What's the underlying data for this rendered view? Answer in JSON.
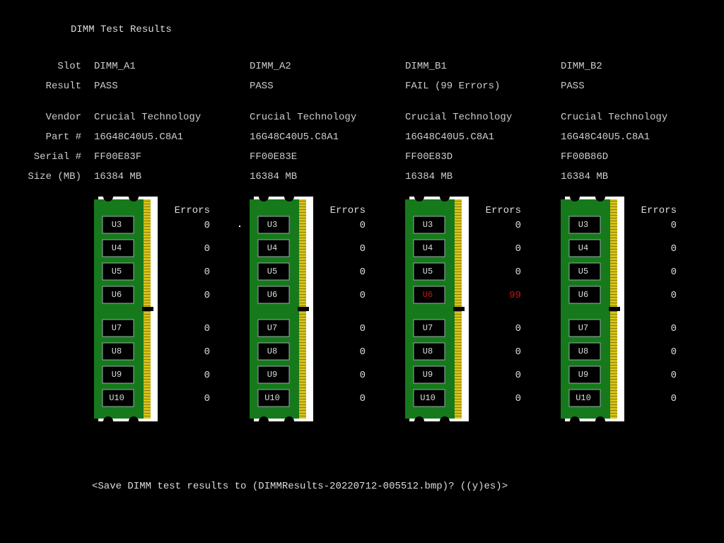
{
  "title": "DIMM Test Results",
  "row_labels": {
    "slot": "Slot",
    "result": "Result",
    "vendor": "Vendor",
    "part": "Part #",
    "serial": "Serial #",
    "size": "Size (MB)"
  },
  "errors_header": "Errors",
  "columns": [
    {
      "slot": "DIMM_A1",
      "result": "PASS",
      "result_status": "pass",
      "vendor": "Crucial Technology",
      "part": "16G48C40U5.C8A1",
      "serial": "FF00E83F",
      "size": "16384 MB",
      "chips": [
        {
          "label": "U3",
          "errors": "0",
          "bad": false
        },
        {
          "label": "U4",
          "errors": "0",
          "bad": false
        },
        {
          "label": "U5",
          "errors": "0",
          "bad": false
        },
        {
          "label": "U6",
          "errors": "0",
          "bad": false
        },
        {
          "label": "U7",
          "errors": "0",
          "bad": false
        },
        {
          "label": "U8",
          "errors": "0",
          "bad": false
        },
        {
          "label": "U9",
          "errors": "0",
          "bad": false
        },
        {
          "label": "U10",
          "errors": "0",
          "bad": false
        }
      ]
    },
    {
      "slot": "DIMM_A2",
      "result": "PASS",
      "result_status": "pass",
      "vendor": "Crucial Technology",
      "part": "16G48C40U5.C8A1",
      "serial": "FF00E83E",
      "size": "16384 MB",
      "chips": [
        {
          "label": "U3",
          "errors": "0",
          "bad": false
        },
        {
          "label": "U4",
          "errors": "0",
          "bad": false
        },
        {
          "label": "U5",
          "errors": "0",
          "bad": false
        },
        {
          "label": "U6",
          "errors": "0",
          "bad": false
        },
        {
          "label": "U7",
          "errors": "0",
          "bad": false
        },
        {
          "label": "U8",
          "errors": "0",
          "bad": false
        },
        {
          "label": "U9",
          "errors": "0",
          "bad": false
        },
        {
          "label": "U10",
          "errors": "0",
          "bad": false
        }
      ]
    },
    {
      "slot": "DIMM_B1",
      "result": "FAIL (99 Errors)",
      "result_status": "fail",
      "vendor": "Crucial Technology",
      "part": "16G48C40U5.C8A1",
      "serial": "FF00E83D",
      "size": "16384 MB",
      "chips": [
        {
          "label": "U3",
          "errors": "0",
          "bad": false
        },
        {
          "label": "U4",
          "errors": "0",
          "bad": false
        },
        {
          "label": "U5",
          "errors": "0",
          "bad": false
        },
        {
          "label": "U6",
          "errors": "99",
          "bad": true
        },
        {
          "label": "U7",
          "errors": "0",
          "bad": false
        },
        {
          "label": "U8",
          "errors": "0",
          "bad": false
        },
        {
          "label": "U9",
          "errors": "0",
          "bad": false
        },
        {
          "label": "U10",
          "errors": "0",
          "bad": false
        }
      ]
    },
    {
      "slot": "DIMM_B2",
      "result": "PASS",
      "result_status": "pass",
      "vendor": "Crucial Technology",
      "part": "16G48C40U5.C8A1",
      "serial": "FF00B86D",
      "size": "16384 MB",
      "chips": [
        {
          "label": "U3",
          "errors": "0",
          "bad": false
        },
        {
          "label": "U4",
          "errors": "0",
          "bad": false
        },
        {
          "label": "U5",
          "errors": "0",
          "bad": false
        },
        {
          "label": "U6",
          "errors": "0",
          "bad": false
        },
        {
          "label": "U7",
          "errors": "0",
          "bad": false
        },
        {
          "label": "U8",
          "errors": "0",
          "bad": false
        },
        {
          "label": "U9",
          "errors": "0",
          "bad": false
        },
        {
          "label": "U10",
          "errors": "0",
          "bad": false
        }
      ]
    }
  ],
  "prompt": "<Save DIMM test results to (DIMMResults-20220712-005512.bmp)? ((y)es)>"
}
